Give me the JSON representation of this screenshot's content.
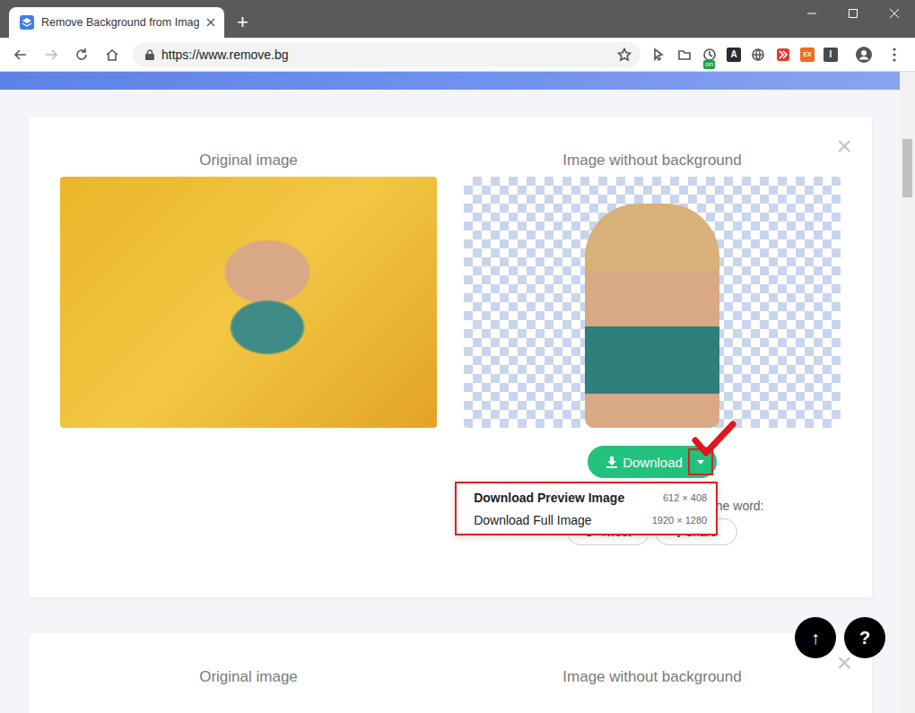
{
  "window": {
    "tab_title": "Remove Background from Imag",
    "new_tab": "+"
  },
  "address_bar": {
    "url": "https://www.remove.bg"
  },
  "extensions": [
    {
      "kind": "cursor"
    },
    {
      "kind": "folder"
    },
    {
      "kind": "clock",
      "badge": "on"
    },
    {
      "kind": "tile",
      "label": "A",
      "color": "#2b2b2b"
    },
    {
      "kind": "globe"
    },
    {
      "kind": "forward",
      "color": "#e53935"
    },
    {
      "kind": "tile",
      "label": "EX",
      "color": "#f26b1d"
    },
    {
      "kind": "tile",
      "label": "I",
      "color": "#4a4a4a"
    }
  ],
  "cards": [
    {
      "original_label": "Original image",
      "result_label": "Image without background",
      "close": "×",
      "expanded": true
    },
    {
      "original_label": "Original image",
      "result_label": "Image without background",
      "close": "×",
      "expanded": false
    }
  ],
  "download": {
    "label": "Download",
    "menu_open": true,
    "menu": [
      {
        "label": "Download Preview Image",
        "size": "612 × 408",
        "selected": true
      },
      {
        "label": "Download Full Image",
        "size": "1920 × 1280",
        "selected": false
      }
    ]
  },
  "share": {
    "prompt": "Happy with the result? Spread the word:",
    "buttons": [
      {
        "label": "Tweet",
        "kind": "twitter"
      },
      {
        "label": "Share",
        "kind": "facebook"
      }
    ]
  },
  "floating": {
    "scroll_top": "↑",
    "help": "?"
  }
}
